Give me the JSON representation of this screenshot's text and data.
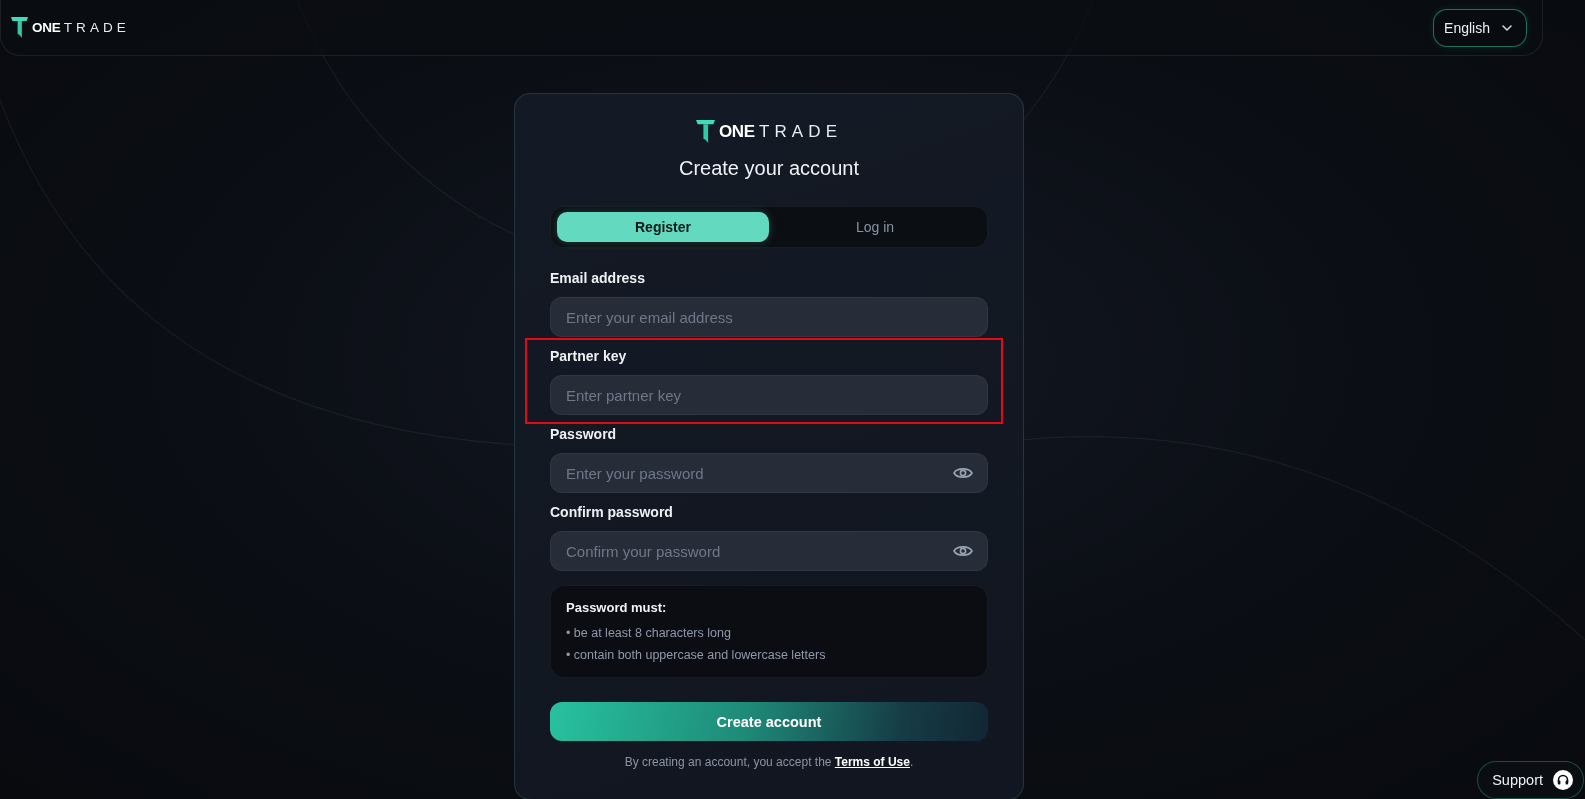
{
  "header": {
    "logo": "**ONE**TRADE",
    "language": "English"
  },
  "card": {
    "logo": "**ONE**TRADE",
    "title": "Create your account",
    "tabs": [
      {
        "label": "Register",
        "selected": true
      },
      {
        "label": "Log in",
        "selected": false
      }
    ],
    "fields": [
      {
        "label": "Email address",
        "placeholder": "Enter your email address",
        "kind": "text",
        "highlighted": false
      },
      {
        "label": "Partner key",
        "placeholder": "Enter partner key",
        "kind": "text",
        "highlighted": true
      },
      {
        "label": "Password",
        "placeholder": "Enter your password",
        "kind": "password",
        "highlighted": false
      },
      {
        "label": "Confirm password",
        "placeholder": "Confirm your password",
        "kind": "password",
        "highlighted": false
      }
    ],
    "requirements": {
      "title": "Password must:",
      "items": [
        "• be at least 8 characters long",
        "• contain both uppercase and lowercase letters"
      ]
    },
    "submit": "Create account",
    "terms": {
      "text": "By creating an account, you accept the ",
      "link": "Terms of Use",
      "end": "."
    }
  },
  "support": "Support"
}
